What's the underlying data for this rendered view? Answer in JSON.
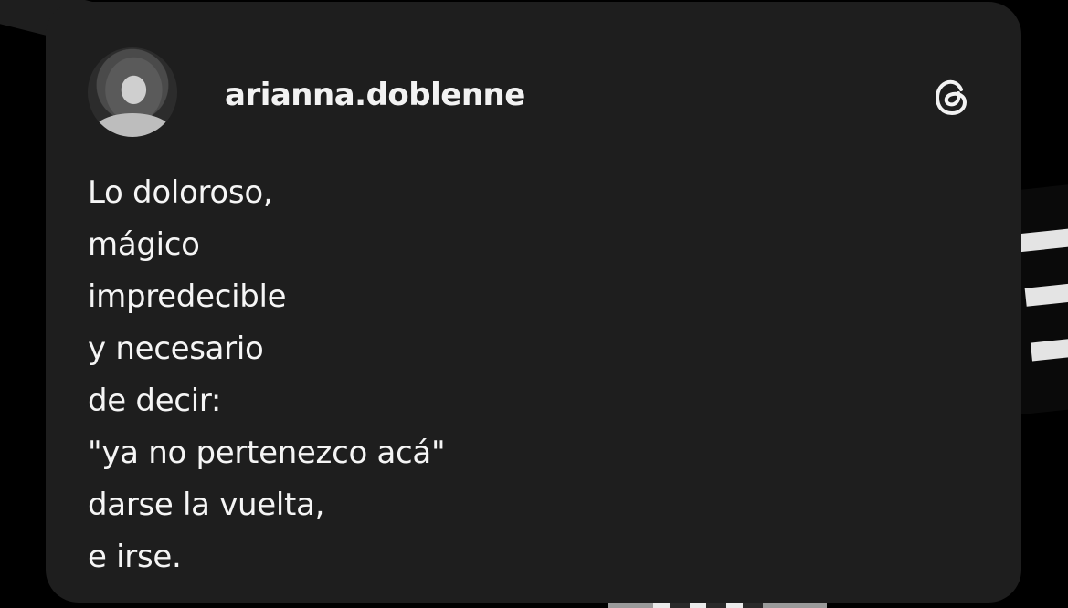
{
  "post": {
    "username": "arianna.doblenne",
    "lines": [
      "Lo doloroso,",
      "mágico",
      "impredecible",
      "y necesario",
      "de decir:",
      "\"ya no pertenezco acá\"",
      "darse la vuelta,",
      "e irse."
    ]
  },
  "icons": {
    "brand": "threads-logo-icon"
  },
  "colors": {
    "background": "#000000",
    "card": "#1e1e1e",
    "text": "#f5f5f5"
  }
}
